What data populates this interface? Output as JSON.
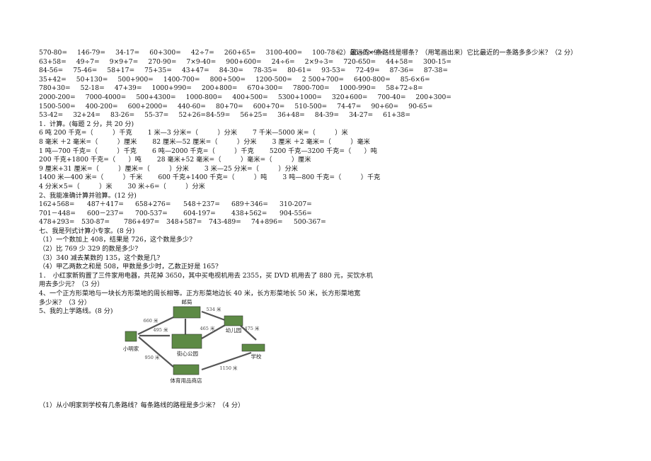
{
  "drill_rows": [
    [
      "570-80=",
      "146-79=",
      "34-17=",
      "60+300=",
      "42÷7=",
      "260+65=",
      "3100-400=",
      "100-78=",
      "35÷5×9="
    ],
    [
      "63+58=",
      "49÷7=",
      "9×9+7=",
      "270-90=",
      "7×9-40=",
      "900+600=",
      "24÷6=",
      "2×9÷3=",
      "720-650=",
      "44+58=",
      "300-15="
    ],
    [
      "84-56=",
      "75-46=",
      "58+17=",
      "75+35=",
      "43+47=",
      "84-30=",
      "78-35=",
      "80-61=",
      "93-53=",
      "72-49=",
      "87-36=",
      "87-38="
    ],
    [
      "35+42=",
      "50+130=",
      "500+900=",
      "1400-700=",
      "800+500=",
      "1200-500=",
      "2 500+700=",
      "6400-800=",
      "85-6×6="
    ],
    [
      "780+30=",
      "52-18=",
      "47+39=",
      "1000+990=",
      "200+800=",
      "670+300=",
      "7800-700=",
      "1000-990=",
      "58+72÷8="
    ],
    [
      "2000-200=",
      "7000-4000=",
      "500+4300=",
      "1000-800=",
      "400+500=",
      "5300+1000=",
      "320+600=",
      "700-40=",
      "200+300="
    ],
    [
      "1500-500=",
      "400-200=",
      "600+2000=",
      "440-60=",
      "80+70=",
      "600+70=",
      "510-500=",
      "74-47=",
      "90+60=",
      "90-65="
    ],
    [
      "53-42=",
      "32+24=",
      "83-26=",
      "55-37=",
      "52+26=84-59=",
      "56+25=",
      "36+48=",
      "84-39=",
      "34-27=",
      "61+38="
    ]
  ],
  "section1": {
    "title": "1．计算。(每题 2 分，共 20 分)",
    "rows": [
      [
        "6 吨 200 千克=（　　　）千克",
        "1 米—3 分米=（　　　）分米",
        "7 千米—5000 米=（　　　）米"
      ],
      [
        "8 毫米 ＋2 毫米=（　　　）厘米",
        "82 厘米—52 厘米=（　　　）分米",
        "3 厘米 ＋2 毫米=（　　　）毫米"
      ],
      [
        "1 吨—700 千克=（　　　）千克",
        "6 吨—2000 千克=（　　　）千克",
        "5200 千克—3200 千克=（　　）吨"
      ],
      [
        "200 千克+1800 千克=（　　）吨",
        "28 毫米+52 毫米=（　　　）毫米=（　　　）厘米"
      ],
      [
        "9 厘米+31 厘米=（　　　）厘米=（　　　）分米",
        "3 米—25 分米=（　　　）分米"
      ],
      [
        "1400 米—400 米=（　　　）千米",
        "600 千克+1400 千克=（　　　）吨",
        "3 吨—800 千克=（　　　）千克"
      ],
      [
        "4 分米×5=（　　　）米",
        "30 米÷6=（　　　）分米"
      ]
    ]
  },
  "section2": {
    "title": "2、我能准确计算并验算。(12 分)",
    "rows": [
      [
        "162+568=",
        "487＋417=",
        "658+276=",
        "548＋237=",
        "689＋346=",
        "310-207="
      ],
      [
        "701－448=",
        "600－237=",
        "700-537=",
        "604-197=",
        "438+562=",
        "904-556="
      ],
      [
        "478+293=",
        "530-87=",
        "786+497=",
        "348+587=",
        "743-489=",
        "74+896=",
        "500-367="
      ]
    ]
  },
  "section7": {
    "title": "七、我是列式计算小专家。(8 分)",
    "items": [
      "（1）一个数加上 408，结果是 726，这个数是多少?",
      "（2）比 769 少 329 的数是多少?",
      "（3）340 减去某数的 135，这个数是几?",
      "（4）甲乙两数之和是 508，甲数是多少时，乙数正好是 165?"
    ]
  },
  "problems": [
    "1．　小红家新购置了三件家用电器，共花掉 3650，其中买电视机用去 2355，买 DVD 机用去了 880 元，买饮水机",
    "用去多少元？（3 分）",
    "4、一个正方形菜地与一块长方形菜地的周长相等。正方形菜地边长 40 米，长方形菜地长 50 米，长方形菜地宽",
    "多少米？（3 分）",
    "5、我的上学路线。(8 分)"
  ],
  "map": {
    "places": {
      "post_office": "邮局",
      "home": "小明家",
      "park": "街心公园",
      "kindergarten": "幼儿园",
      "school": "学校",
      "store": "体育用品商店"
    },
    "distances": {
      "home_post": "660 米",
      "post_kinder": "534 米",
      "home_park": "495 米",
      "park_kinder": "465 米",
      "kinder_school": "475 米",
      "home_store": "950 米",
      "store_school": "1150 米"
    },
    "colors": {
      "building": "#4f7a3a",
      "road": "#555555"
    }
  },
  "question1": "（1）从小明家到学校有几条路线？每条路线的路程是多少米？（4 分）",
  "question2": "（2）最远的一条路线是哪条？（用笔画出来）它比最近的一条路多多少米？（2 分）"
}
